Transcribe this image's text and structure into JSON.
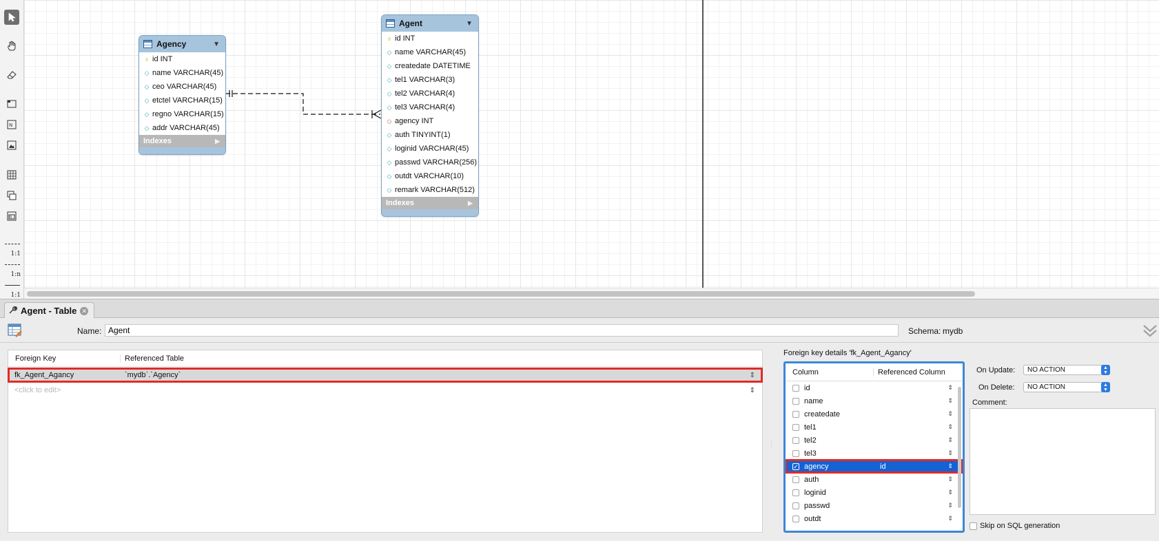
{
  "toolbar": {
    "tools": [
      "pointer-tool",
      "hand-tool",
      "eraser-tool",
      "layer-tool",
      "text-note-tool",
      "image-tool",
      "new-table-tool",
      "new-view-tool",
      "new-routine-group-tool"
    ],
    "relationships": [
      {
        "name": "one-to-one-relationship-tool",
        "label": "1:1"
      },
      {
        "name": "one-to-many-relationship-tool",
        "label": "1:n"
      },
      {
        "name": "one-to-one-identifying-relationship-tool",
        "label": "1:1"
      }
    ]
  },
  "diagram": {
    "agency": {
      "title": "Agency",
      "columns": [
        {
          "marker": "pk",
          "text": "id INT"
        },
        {
          "marker": "col",
          "text": "name VARCHAR(45)"
        },
        {
          "marker": "col",
          "text": "ceo VARCHAR(45)"
        },
        {
          "marker": "col",
          "text": "etctel VARCHAR(15)"
        },
        {
          "marker": "col",
          "text": "regno VARCHAR(15)"
        },
        {
          "marker": "col",
          "text": "addr VARCHAR(45)"
        }
      ],
      "indexes_label": "Indexes"
    },
    "agent": {
      "title": "Agent",
      "columns": [
        {
          "marker": "pk",
          "text": "id INT"
        },
        {
          "marker": "col",
          "text": "name VARCHAR(45)"
        },
        {
          "marker": "col",
          "text": "createdate DATETIME"
        },
        {
          "marker": "col",
          "text": "tel1 VARCHAR(3)"
        },
        {
          "marker": "col",
          "text": "tel2 VARCHAR(4)"
        },
        {
          "marker": "col",
          "text": "tel3 VARCHAR(4)"
        },
        {
          "marker": "fk",
          "text": "agency INT"
        },
        {
          "marker": "col",
          "text": "auth TINYINT(1)"
        },
        {
          "marker": "col",
          "text": "loginid VARCHAR(45)"
        },
        {
          "marker": "col",
          "text": "passwd VARCHAR(256)"
        },
        {
          "marker": "col",
          "text": "outdt VARCHAR(10)"
        },
        {
          "marker": "col",
          "text": "remark VARCHAR(512)"
        }
      ],
      "indexes_label": "Indexes"
    }
  },
  "editor": {
    "tab_label": "Agent - Table",
    "name_label": "Name:",
    "name_value": "Agent",
    "schema_label": "Schema:",
    "schema_value": "mydb"
  },
  "foreign_keys": {
    "headers": {
      "foreign_key": "Foreign Key",
      "referenced_table": "Referenced Table"
    },
    "rows": [
      {
        "name": "fk_Agent_Agancy",
        "table": "`mydb`.`Agency`",
        "selected": true
      }
    ],
    "placeholder": "<click to edit>"
  },
  "fk_details": {
    "title": "Foreign key details 'fk_Agent_Agancy'",
    "headers": {
      "column": "Column",
      "referenced_column": "Referenced Column"
    },
    "rows": [
      {
        "column": "id",
        "ref": "",
        "checked": false
      },
      {
        "column": "name",
        "ref": "",
        "checked": false
      },
      {
        "column": "createdate",
        "ref": "",
        "checked": false
      },
      {
        "column": "tel1",
        "ref": "",
        "checked": false
      },
      {
        "column": "tel2",
        "ref": "",
        "checked": false
      },
      {
        "column": "tel3",
        "ref": "",
        "checked": false
      },
      {
        "column": "agency",
        "ref": "id",
        "checked": true,
        "selected": true
      },
      {
        "column": "auth",
        "ref": "",
        "checked": false
      },
      {
        "column": "loginid",
        "ref": "",
        "checked": false
      },
      {
        "column": "passwd",
        "ref": "",
        "checked": false
      },
      {
        "column": "outdt",
        "ref": "",
        "checked": false
      }
    ]
  },
  "options": {
    "on_update_label": "On Update:",
    "on_update_value": "NO ACTION",
    "on_delete_label": "On Delete:",
    "on_delete_value": "NO ACTION",
    "comment_label": "Comment:",
    "comment_value": "",
    "skip_label": "Skip on SQL generation",
    "skip_checked": false
  },
  "colors": {
    "entity_header": "#a7c4dd",
    "selection_blue": "#1463d5",
    "highlight_red": "#e12a26",
    "focus_ring": "#3c86d6"
  }
}
